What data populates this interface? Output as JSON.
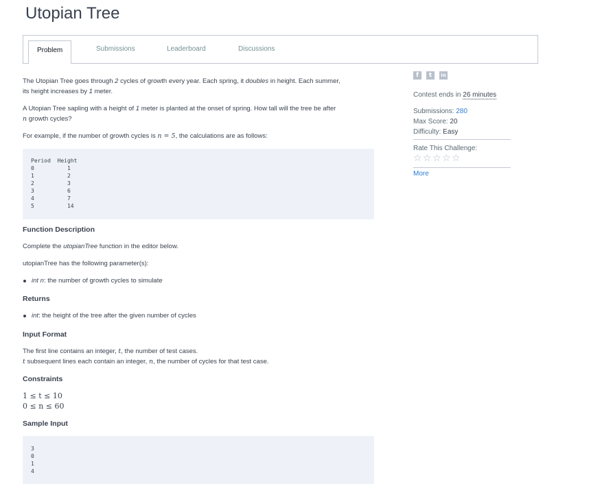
{
  "page": {
    "title": "Utopian Tree"
  },
  "tabs": [
    {
      "label": "Problem",
      "active": true
    },
    {
      "label": "Submissions"
    },
    {
      "label": "Leaderboard"
    },
    {
      "label": "Discussions"
    }
  ],
  "problem": {
    "p1a": "The Utopian Tree goes through ",
    "p1b": "2",
    "p1c": " cycles of growth every year. Each spring, it ",
    "p1d": "doubles",
    "p1e": " in height. Each summer,",
    "p1f": "its height increases by ",
    "p1g": "1",
    "p1h": " meter.",
    "p2a": "A Utopian Tree sapling with a height of ",
    "p2b": "1",
    "p2c": " meter is planted at the onset of spring. How tall will the tree be after",
    "p2d": "n",
    "p2e": " growth cycles?",
    "p3a": "For example, if the number of growth cycles is ",
    "p3b": "n = 5",
    "p3c": ", the calculations are as follows:",
    "table_header": "Period  Height",
    "table_rows": [
      "0          1",
      "1          2",
      "2          3",
      "3          6",
      "4          7",
      "5          14"
    ],
    "function_description_heading": "Function Description",
    "fd1a": "Complete the ",
    "fd1b": "utopianTree",
    "fd1c": " function in the editor below.",
    "fd2": "utopianTree has the following parameter(s):",
    "param1a": "int n",
    "param1b": ": the number of growth cycles to simulate",
    "returns_heading": "Returns",
    "ret1a": "int",
    "ret1b": ": the height of the tree after the given number of cycles",
    "input_format_heading": "Input Format",
    "if1a": "The first line contains an integer, ",
    "if1b": "t",
    "if1c": ", the number of test cases.",
    "if2a": "t",
    "if2b": " subsequent lines each contain an integer, ",
    "if2c": "n",
    "if2d": ", the number of cycles for that test case.",
    "constraints_heading": "Constraints",
    "c1": "1 ≤ t ≤ 10",
    "c2": "0 ≤ n ≤ 60",
    "sample_input_heading": "Sample Input",
    "sample_input": [
      "3",
      "0",
      "1",
      "4"
    ]
  },
  "sidebar": {
    "social": [
      "f",
      "t",
      "in"
    ],
    "contest_label": "Contest ends in ",
    "contest_time": "26 minutes",
    "submissions_label": "Submissions: ",
    "submissions_value": "280",
    "max_score_label": "Max Score: ",
    "max_score_value": "20",
    "difficulty_label": "Difficulty: ",
    "difficulty_value": "Easy",
    "rate_label": "Rate This Challenge:",
    "stars": [
      "☆",
      "☆",
      "☆",
      "☆",
      "☆"
    ],
    "more": "More"
  }
}
